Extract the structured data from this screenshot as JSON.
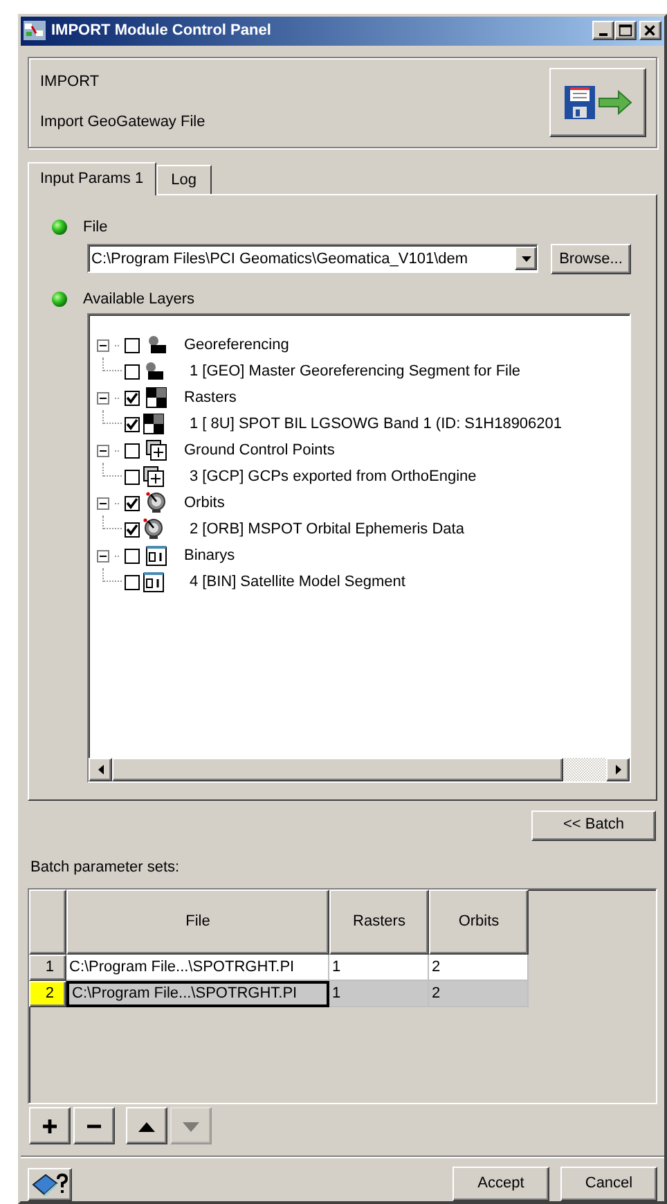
{
  "window": {
    "title": "IMPORT Module Control Panel"
  },
  "header": {
    "title": "IMPORT",
    "subtitle": "Import GeoGateway File"
  },
  "tabs": [
    {
      "label": "Input Params 1",
      "selected": true
    },
    {
      "label": "Log",
      "selected": false
    }
  ],
  "file": {
    "label": "File",
    "value": "C:\\Program Files\\PCI Geomatics\\Geomatica_V101\\dem",
    "browse": "Browse..."
  },
  "layers": {
    "label": "Available Layers",
    "items": [
      {
        "label": "Georeferencing",
        "kind": "georef",
        "checked": false,
        "expanded": true,
        "children": [
          {
            "label": "1 [GEO] Master Georeferencing Segment for File",
            "kind": "georef",
            "checked": false
          }
        ]
      },
      {
        "label": "Rasters",
        "kind": "raster",
        "checked": true,
        "expanded": true,
        "children": [
          {
            "label": "1 [ 8U] SPOT BIL LGSOWG Band  1 (ID: S1H18906201",
            "kind": "raster",
            "checked": true
          }
        ]
      },
      {
        "label": "Ground Control Points",
        "kind": "gcp",
        "checked": false,
        "expanded": true,
        "children": [
          {
            "label": "3 [GCP] GCPs exported from OrthoEngine",
            "kind": "gcp",
            "checked": false
          }
        ]
      },
      {
        "label": "Orbits",
        "kind": "orbit",
        "checked": true,
        "expanded": true,
        "children": [
          {
            "label": "2 [ORB] MSPOT Orbital Ephemeris Data",
            "kind": "orbit",
            "checked": true
          }
        ]
      },
      {
        "label": "Binarys",
        "kind": "binary",
        "checked": false,
        "expanded": true,
        "children": [
          {
            "label": "4 [BIN] Satellite Model Segment",
            "kind": "binary",
            "checked": false
          }
        ]
      }
    ]
  },
  "batch_button": "<< Batch",
  "batch": {
    "label": "Batch parameter sets:",
    "columns": [
      "File",
      "Rasters",
      "Orbits"
    ],
    "rows": [
      {
        "number": "1",
        "file": "C:\\Program File...\\SPOTRGHT.PI",
        "rasters": "1",
        "orbits": "2",
        "selected": false
      },
      {
        "number": "2",
        "file": "C:\\Program File...\\SPOTRGHT.PI",
        "rasters": "1",
        "orbits": "2",
        "selected": true
      }
    ]
  },
  "row_buttons": [
    {
      "kind": "add",
      "disabled": false
    },
    {
      "kind": "remove",
      "disabled": false
    },
    {
      "kind": "up",
      "disabled": false
    },
    {
      "kind": "down",
      "disabled": true
    }
  ],
  "buttons": [
    "Accept",
    "Cancel"
  ]
}
